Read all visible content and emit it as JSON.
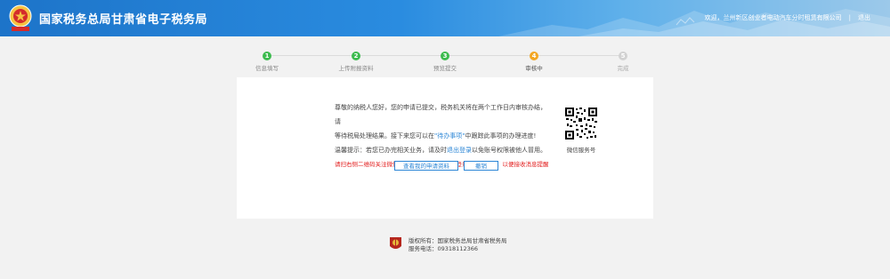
{
  "header": {
    "title": "国家税务总局甘肃省电子税务局",
    "welcome": "欢迎，兰州新区创业者电动汽车分时租赁有限公司",
    "separator": "|",
    "logout": "退出",
    "logo_icon": "tax-emblem-icon"
  },
  "steps": [
    {
      "num": "1",
      "label": "信息填写",
      "state": "done"
    },
    {
      "num": "2",
      "label": "上传附报资料",
      "state": "done"
    },
    {
      "num": "3",
      "label": "预览提交",
      "state": "done"
    },
    {
      "num": "4",
      "label": "审核中",
      "state": "current"
    },
    {
      "num": "5",
      "label": "完成",
      "state": "todo"
    }
  ],
  "message": {
    "line1": "尊敬的纳税人您好，您的申请已提交，税务机关将在两个工作日内审核办结，请",
    "line2a": "等待税局处理结果。接下来您可以在",
    "line2_link": "\"待办事项\"",
    "line2b": "中跟踪此事项的办理进度!",
    "line3a": "温馨提示：若您已办完相关业务，请及时",
    "line3_link": "退出登录",
    "line3b": "以免账号权限被他人冒用。",
    "warning": "请扫右侧二维码关注微信服务号，并在服务号中登录网上税务局，以便接收消息提醒"
  },
  "qr": {
    "caption": "微信服务号",
    "icon": "qr-code-icon"
  },
  "buttons": {
    "view": "查看我的申请资料",
    "cancel": "撤销"
  },
  "footer": {
    "copyright": "版权所有：国家税务总局甘肃省税务局",
    "phone": "服务电话：09318112366",
    "logo_icon": "tax-badge-icon"
  },
  "colors": {
    "header_blue": "#1d74c9",
    "done_green": "#3dbb4f",
    "current_orange": "#f3a623",
    "link_blue": "#2b86d6",
    "warning_red": "#e21b1b"
  }
}
